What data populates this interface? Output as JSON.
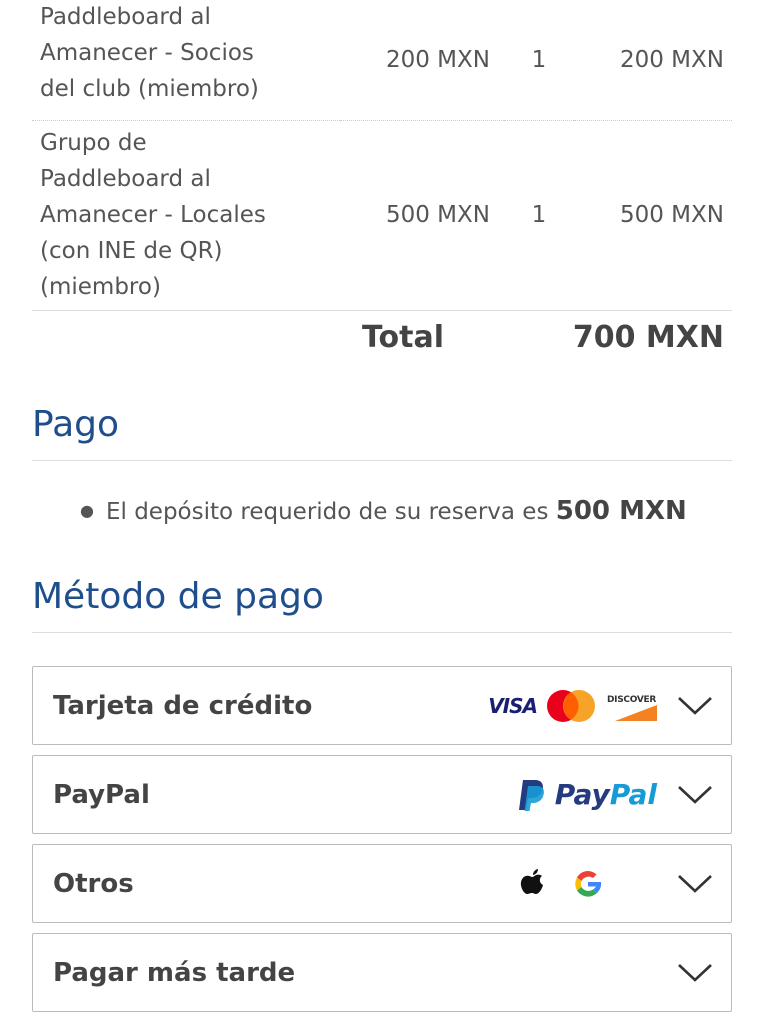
{
  "order": {
    "rows": [
      {
        "desc_lines": [
          "Paddleboard al",
          "Amanecer - Socios",
          "del club (miembro)"
        ],
        "price": "200 MXN",
        "qty": "1",
        "subtotal": "200 MXN"
      },
      {
        "desc_lines": [
          "Grupo de",
          "Paddleboard al",
          "Amanecer - Locales",
          "(con INE de QR)",
          "(miembro)"
        ],
        "price": "500 MXN",
        "qty": "1",
        "subtotal": "500 MXN"
      }
    ],
    "total_label": "Total",
    "total_value": "700 MXN"
  },
  "pago": {
    "title": "Pago",
    "deposit_text": "El depósito requerido de su reserva es",
    "deposit_amount": "500 MXN"
  },
  "metodo": {
    "title": "Método de pago",
    "methods": [
      {
        "label": "Tarjeta de crédito",
        "icons": [
          "visa-logo",
          "mastercard-logo",
          "discover-logo"
        ]
      },
      {
        "label": "PayPal",
        "icons": [
          "paypal-logo"
        ]
      },
      {
        "label": "Otros",
        "icons": [
          "apple-icon",
          "google-icon"
        ]
      },
      {
        "label": "Pagar más tarde",
        "icons": []
      }
    ]
  },
  "logos": {
    "visa": "VISA",
    "discover": "DISCOVER",
    "paypal_a": "Pay",
    "paypal_b": "Pal"
  },
  "colors": {
    "heading_blue": "#1f4e8c",
    "mastercard_red": "#eb001b",
    "mastercard_orange": "#f79e1b",
    "paypal_dark": "#253b80",
    "paypal_light": "#179bd7"
  }
}
